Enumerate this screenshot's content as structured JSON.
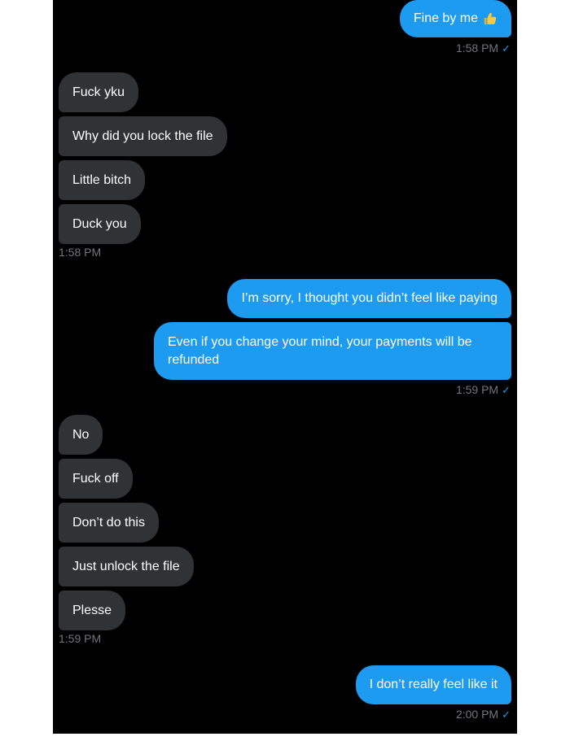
{
  "colors": {
    "screen_bg": "#000000",
    "sent_bubble": "#1d9bf0",
    "received_bubble": "#2f3336",
    "timestamp": "#71767b",
    "read_check": "#1d9bf0"
  },
  "messages": {
    "m1": {
      "text": "Fine by me",
      "emoji_icon": "thumbs-up-icon",
      "direction": "sent"
    },
    "t1": "1:58 PM",
    "m2": {
      "text": "Fuck yku",
      "direction": "received"
    },
    "m3": {
      "text": "Why did you lock the file",
      "direction": "received"
    },
    "m4": {
      "text": "Little bitch",
      "direction": "received"
    },
    "m5": {
      "text": "Duck you",
      "direction": "received"
    },
    "t2": "1:58 PM",
    "m6": {
      "text": "I’m sorry, I thought you didn’t feel like paying",
      "direction": "sent"
    },
    "m7": {
      "text": "Even if you change your mind, your payments will be refunded",
      "direction": "sent"
    },
    "t3": "1:59 PM",
    "m8": {
      "text": "No",
      "direction": "received"
    },
    "m9": {
      "text": "Fuck off",
      "direction": "received"
    },
    "m10": {
      "text": "Don’t do this",
      "direction": "received"
    },
    "m11": {
      "text": "Just unlock the file",
      "direction": "received"
    },
    "m12": {
      "text": "Plesse",
      "direction": "received"
    },
    "t4": "1:59 PM",
    "m13": {
      "text": "I don’t really feel like it",
      "direction": "sent"
    },
    "t5": "2:00 PM"
  },
  "read_receipt_icon": "checkmark-icon"
}
